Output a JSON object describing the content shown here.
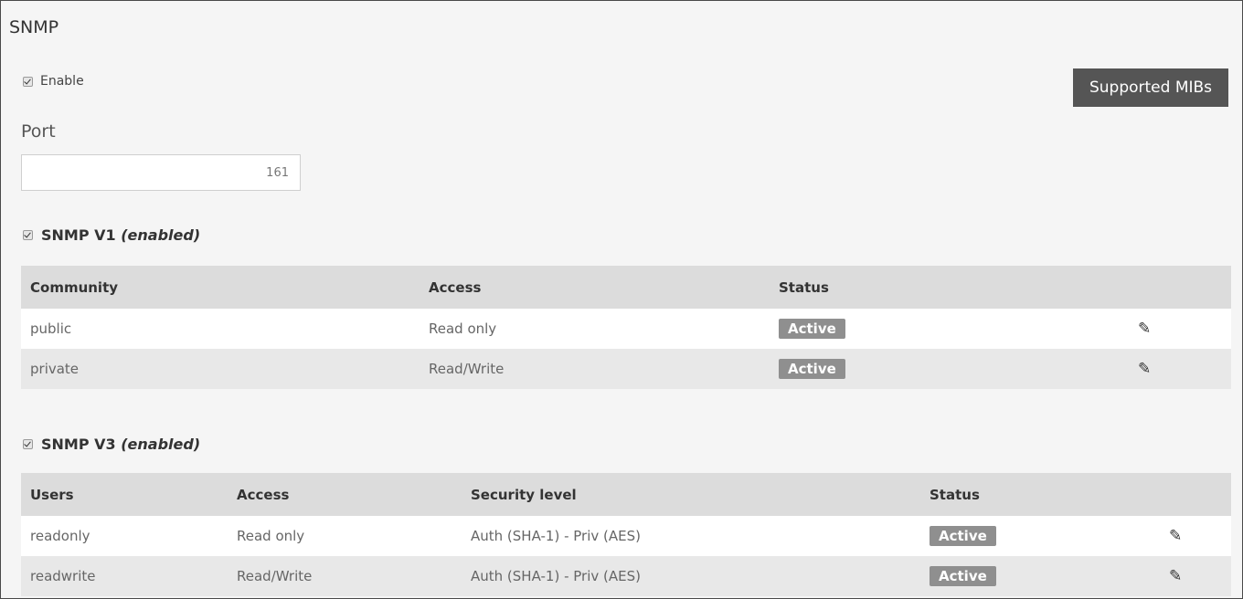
{
  "title": "SNMP",
  "enable": {
    "label": "Enable",
    "checked": true
  },
  "mibs_button": "Supported MIBs",
  "port": {
    "label": "Port",
    "value": "161"
  },
  "v1": {
    "name": "SNMP V1",
    "state": "(enabled)",
    "checked": true,
    "columns": [
      "Community",
      "Access",
      "Status"
    ],
    "rows": [
      {
        "community": "public",
        "access": "Read only",
        "status": "Active"
      },
      {
        "community": "private",
        "access": "Read/Write",
        "status": "Active"
      }
    ]
  },
  "v3": {
    "name": "SNMP V3",
    "state": "(enabled)",
    "checked": true,
    "columns": [
      "Users",
      "Access",
      "Security level",
      "Status"
    ],
    "rows": [
      {
        "user": "readonly",
        "access": "Read only",
        "security": "Auth (SHA-1) - Priv (AES)",
        "status": "Active"
      },
      {
        "user": "readwrite",
        "access": "Read/Write",
        "security": "Auth (SHA-1) - Priv (AES)",
        "status": "Active"
      }
    ]
  },
  "icons": {
    "edit": "pencil-icon",
    "checkbox": "checkbox-checked"
  },
  "colors": {
    "button": "#555555",
    "badge": "#8f8f8f",
    "header_row": "#dcdcdc"
  }
}
